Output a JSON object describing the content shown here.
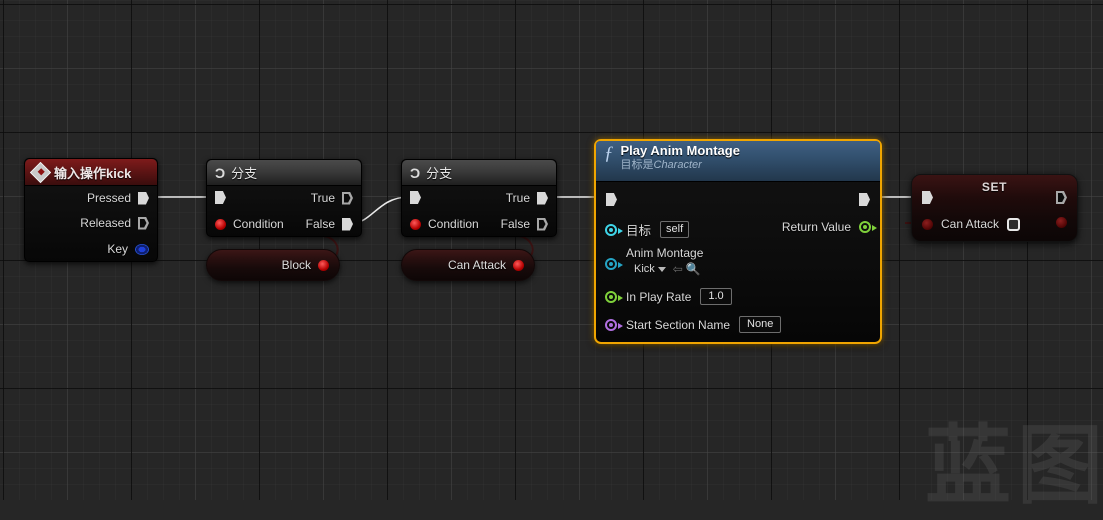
{
  "graph": {
    "background_color": "#262626",
    "grid_line_color": "#373737",
    "selection_color": "#f0a500",
    "watermark": "蓝图"
  },
  "nodes": {
    "input_event": {
      "title": "输入操作kick",
      "icon": "input-event-diamond-icon",
      "header_color": "#5d1414",
      "pins": [
        {
          "label": "Pressed",
          "type": "exec",
          "filled": true
        },
        {
          "label": "Released",
          "type": "exec",
          "filled": false
        },
        {
          "label": "Key",
          "type": "struct"
        }
      ]
    },
    "branch_block": {
      "title": "分支",
      "icon": "branch-icon",
      "in_exec": "",
      "condition_label": "Condition",
      "true_label": "True",
      "false_label": "False",
      "true_filled": false,
      "false_filled": true
    },
    "branch_can_attack": {
      "title": "分支",
      "icon": "branch-icon",
      "in_exec": "",
      "condition_label": "Condition",
      "true_label": "True",
      "false_label": "False",
      "true_filled": true,
      "false_filled": false
    },
    "getter_block": {
      "label": "Block"
    },
    "getter_can_attack": {
      "label": "Can Attack"
    },
    "play_anim_montage": {
      "title": "Play Anim Montage",
      "subtitle_prefix": "目标是",
      "subtitle_target": "Character",
      "selected": true,
      "inputs": [
        {
          "name": "目标",
          "value": "self",
          "pin": "object"
        },
        {
          "name": "Anim Montage",
          "value": "Kick",
          "pin": "object"
        },
        {
          "name": "In Play Rate",
          "value": "1.0",
          "pin": "float"
        },
        {
          "name": "Start Section Name",
          "value": "None",
          "pin": "name"
        }
      ],
      "outputs": [
        {
          "name": "Return Value",
          "pin": "bool-green"
        }
      ]
    },
    "set_node": {
      "title": "SET",
      "variable_label": "Can Attack",
      "checkbox_checked": false
    }
  }
}
